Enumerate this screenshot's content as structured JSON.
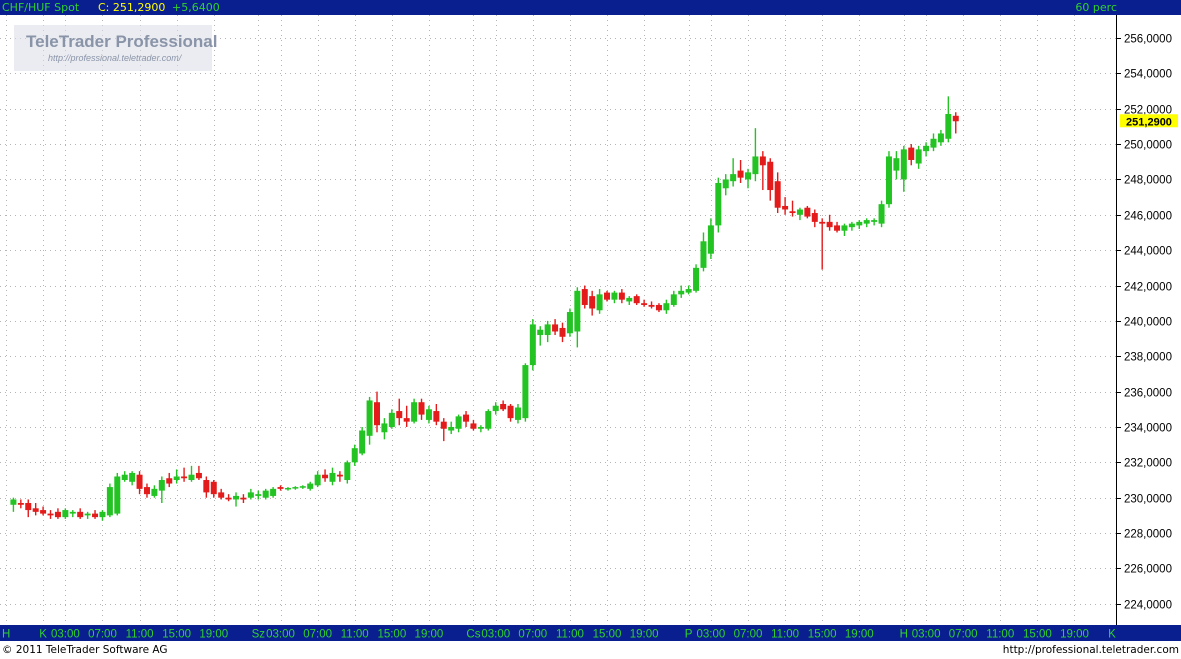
{
  "header": {
    "symbol": "CHF/HUF Spot",
    "close_label": "C: 251,2900",
    "change": "+5,6400",
    "interval": "60 perc"
  },
  "watermark": {
    "brand": "TeleTrader Professional",
    "url": "http://professional.teletrader.com/"
  },
  "footer": {
    "copyright": "© 2011 TeleTrader Software AG",
    "site": "http://professional.teletrader.com"
  },
  "colors": {
    "up": "#22c322",
    "down": "#e31b1b",
    "neutral": "#38d4d4",
    "grid": "#b5b5b5",
    "bar": "#0a1f8f",
    "bar_text": "#2fd12f",
    "highlight": "#ffff00"
  },
  "chart_data": {
    "type": "candlestick",
    "title": "CHF/HUF Spot",
    "interval": "60 perc",
    "last_value": 251.29,
    "last_value_label": "251,2900",
    "y_axis": {
      "position": "right",
      "range": [
        222.8,
        257.3
      ],
      "ticks": [
        224,
        226,
        228,
        230,
        232,
        234,
        236,
        238,
        240,
        242,
        244,
        246,
        248,
        250,
        252,
        254,
        256
      ],
      "tick_labels": [
        "224,0000",
        "226,0000",
        "228,0000",
        "230,0000",
        "232,0000",
        "234,0000",
        "236,0000",
        "238,0000",
        "240,0000",
        "242,0000",
        "244,0000",
        "246,0000",
        "248,0000",
        "250,0000",
        "252,0000",
        "254,0000",
        "256,0000"
      ]
    },
    "x_axis": {
      "slot_count": 150,
      "labels": [
        {
          "slot": 0,
          "text": "H"
        },
        {
          "slot": 5,
          "text": "K"
        },
        {
          "slot": 8,
          "text": "03:00"
        },
        {
          "slot": 13,
          "text": "07:00"
        },
        {
          "slot": 18,
          "text": "11:00"
        },
        {
          "slot": 23,
          "text": "15:00"
        },
        {
          "slot": 28,
          "text": "19:00"
        },
        {
          "slot": 34,
          "text": "Sz"
        },
        {
          "slot": 37,
          "text": "03:00"
        },
        {
          "slot": 42,
          "text": "07:00"
        },
        {
          "slot": 47,
          "text": "11:00"
        },
        {
          "slot": 52,
          "text": "15:00"
        },
        {
          "slot": 57,
          "text": "19:00"
        },
        {
          "slot": 63,
          "text": "Cs"
        },
        {
          "slot": 66,
          "text": "03:00"
        },
        {
          "slot": 71,
          "text": "07:00"
        },
        {
          "slot": 76,
          "text": "11:00"
        },
        {
          "slot": 81,
          "text": "15:00"
        },
        {
          "slot": 86,
          "text": "19:00"
        },
        {
          "slot": 92,
          "text": "P"
        },
        {
          "slot": 95,
          "text": "03:00"
        },
        {
          "slot": 100,
          "text": "07:00"
        },
        {
          "slot": 105,
          "text": "11:00"
        },
        {
          "slot": 110,
          "text": "15:00"
        },
        {
          "slot": 115,
          "text": "19:00"
        },
        {
          "slot": 121,
          "text": "H"
        },
        {
          "slot": 124,
          "text": "03:00"
        },
        {
          "slot": 129,
          "text": "07:00"
        },
        {
          "slot": 134,
          "text": "11:00"
        },
        {
          "slot": 139,
          "text": "15:00"
        },
        {
          "slot": 144,
          "text": "19:00"
        },
        {
          "slot": 150,
          "text": "K"
        }
      ]
    },
    "grid": true,
    "candles": [
      {
        "slot": 1,
        "o": 229.6,
        "h": 230.0,
        "l": 229.2,
        "c": 229.9
      },
      {
        "slot": 2,
        "o": 229.7,
        "h": 229.9,
        "l": 229.4,
        "c": 229.6
      },
      {
        "slot": 3,
        "o": 229.7,
        "h": 229.9,
        "l": 228.9,
        "c": 229.3
      },
      {
        "slot": 4,
        "o": 229.4,
        "h": 229.7,
        "l": 229.0,
        "c": 229.2
      },
      {
        "slot": 5,
        "o": 229.3,
        "h": 229.5,
        "l": 229.0,
        "c": 229.1
      },
      {
        "slot": 6,
        "o": 229.1,
        "h": 229.3,
        "l": 228.8,
        "c": 229.0
      },
      {
        "slot": 7,
        "o": 229.2,
        "h": 229.4,
        "l": 228.8,
        "c": 228.9
      },
      {
        "slot": 8,
        "o": 228.9,
        "h": 229.4,
        "l": 228.8,
        "c": 229.3
      },
      {
        "slot": 9,
        "o": 229.1,
        "h": 229.3,
        "l": 228.9,
        "c": 229.2
      },
      {
        "slot": 10,
        "o": 229.2,
        "h": 229.4,
        "l": 228.8,
        "c": 228.9
      },
      {
        "slot": 11,
        "o": 229.0,
        "h": 229.2,
        "l": 228.8,
        "c": 229.1
      },
      {
        "slot": 12,
        "o": 229.1,
        "h": 229.3,
        "l": 228.8,
        "c": 228.9
      },
      {
        "slot": 13,
        "o": 228.9,
        "h": 229.3,
        "l": 228.7,
        "c": 229.2
      },
      {
        "slot": 14,
        "o": 229.0,
        "h": 230.8,
        "l": 228.9,
        "c": 230.6
      },
      {
        "slot": 15,
        "o": 229.1,
        "h": 231.4,
        "l": 229.0,
        "c": 231.2
      },
      {
        "slot": 16,
        "o": 231.0,
        "h": 231.5,
        "l": 230.9,
        "c": 231.3
      },
      {
        "slot": 17,
        "o": 230.9,
        "h": 231.5,
        "l": 230.7,
        "c": 231.4
      },
      {
        "slot": 18,
        "o": 231.3,
        "h": 231.5,
        "l": 230.2,
        "c": 230.5
      },
      {
        "slot": 19,
        "o": 230.6,
        "h": 230.8,
        "l": 230.0,
        "c": 230.2
      },
      {
        "slot": 20,
        "o": 230.1,
        "h": 230.7,
        "l": 230.0,
        "c": 230.5
      },
      {
        "slot": 21,
        "o": 230.4,
        "h": 231.2,
        "l": 229.7,
        "c": 231.0
      },
      {
        "slot": 22,
        "o": 231.1,
        "h": 231.4,
        "l": 230.6,
        "c": 230.8
      },
      {
        "slot": 23,
        "o": 231.0,
        "h": 231.6,
        "l": 230.8,
        "c": 231.2
      },
      {
        "slot": 24,
        "o": 231.2,
        "h": 231.7,
        "l": 230.9,
        "c": 231.1
      },
      {
        "slot": 25,
        "o": 231.0,
        "h": 231.8,
        "l": 230.9,
        "c": 231.3
      },
      {
        "slot": 26,
        "o": 231.4,
        "h": 231.8,
        "l": 231.0,
        "c": 231.1
      },
      {
        "slot": 27,
        "o": 231.0,
        "h": 231.2,
        "l": 230.0,
        "c": 230.3
      },
      {
        "slot": 28,
        "o": 230.9,
        "h": 231.0,
        "l": 230.0,
        "c": 230.2
      },
      {
        "slot": 29,
        "o": 230.3,
        "h": 230.5,
        "l": 229.9,
        "c": 230.0
      },
      {
        "slot": 30,
        "o": 230.0,
        "h": 230.2,
        "l": 229.8,
        "c": 229.9
      },
      {
        "slot": 31,
        "o": 229.9,
        "h": 230.3,
        "l": 229.5,
        "c": 230.1
      },
      {
        "slot": 32,
        "o": 230.0,
        "h": 230.2,
        "l": 229.7,
        "c": 229.9
      },
      {
        "slot": 33,
        "o": 230.0,
        "h": 230.5,
        "l": 229.9,
        "c": 230.3
      },
      {
        "slot": 34,
        "o": 230.1,
        "h": 230.4,
        "l": 229.9,
        "c": 230.2
      },
      {
        "slot": 35,
        "o": 230.0,
        "h": 230.5,
        "l": 229.9,
        "c": 230.4
      },
      {
        "slot": 36,
        "o": 230.1,
        "h": 230.6,
        "l": 230.0,
        "c": 230.5
      },
      {
        "slot": 37,
        "o": 230.6,
        "h": 230.7,
        "l": 230.4,
        "c": 230.5
      },
      {
        "slot": 38,
        "o": 230.5,
        "h": 230.6,
        "l": 230.4,
        "c": 230.55
      },
      {
        "slot": 39,
        "o": 230.55,
        "h": 230.65,
        "l": 230.45,
        "c": 230.6
      },
      {
        "slot": 40,
        "o": 230.6,
        "h": 230.7,
        "l": 230.5,
        "c": 230.65
      },
      {
        "slot": 41,
        "o": 230.5,
        "h": 230.9,
        "l": 230.4,
        "c": 230.8
      },
      {
        "slot": 42,
        "o": 230.7,
        "h": 231.5,
        "l": 230.6,
        "c": 231.3
      },
      {
        "slot": 43,
        "o": 231.3,
        "h": 231.6,
        "l": 230.9,
        "c": 231.1
      },
      {
        "slot": 44,
        "o": 230.9,
        "h": 231.7,
        "l": 230.7,
        "c": 231.4
      },
      {
        "slot": 45,
        "o": 231.3,
        "h": 231.5,
        "l": 230.9,
        "c": 231.2
      },
      {
        "slot": 46,
        "o": 231.0,
        "h": 232.1,
        "l": 230.8,
        "c": 232.0
      },
      {
        "slot": 47,
        "o": 232.0,
        "h": 233.0,
        "l": 231.8,
        "c": 232.8
      },
      {
        "slot": 48,
        "o": 232.5,
        "h": 234.0,
        "l": 232.4,
        "c": 233.8
      },
      {
        "slot": 49,
        "o": 233.5,
        "h": 235.7,
        "l": 233.0,
        "c": 235.5
      },
      {
        "slot": 50,
        "o": 235.4,
        "h": 236.0,
        "l": 233.7,
        "c": 234.1
      },
      {
        "slot": 51,
        "o": 233.7,
        "h": 234.5,
        "l": 233.3,
        "c": 234.2
      },
      {
        "slot": 52,
        "o": 234.0,
        "h": 235.0,
        "l": 233.9,
        "c": 234.8
      },
      {
        "slot": 53,
        "o": 234.9,
        "h": 235.6,
        "l": 234.1,
        "c": 234.5
      },
      {
        "slot": 54,
        "o": 234.5,
        "h": 235.2,
        "l": 234.0,
        "c": 234.3
      },
      {
        "slot": 55,
        "o": 234.3,
        "h": 235.6,
        "l": 234.2,
        "c": 235.4
      },
      {
        "slot": 56,
        "o": 235.4,
        "h": 235.6,
        "l": 234.4,
        "c": 234.7
      },
      {
        "slot": 57,
        "o": 234.4,
        "h": 235.2,
        "l": 234.2,
        "c": 235.0
      },
      {
        "slot": 58,
        "o": 234.9,
        "h": 235.3,
        "l": 234.1,
        "c": 234.3
      },
      {
        "slot": 59,
        "o": 234.3,
        "h": 234.5,
        "l": 233.2,
        "c": 233.9
      },
      {
        "slot": 60,
        "o": 233.8,
        "h": 234.3,
        "l": 233.6,
        "c": 234.0
      },
      {
        "slot": 61,
        "o": 233.9,
        "h": 234.7,
        "l": 233.7,
        "c": 234.6
      },
      {
        "slot": 62,
        "o": 234.7,
        "h": 234.9,
        "l": 234.0,
        "c": 234.3
      },
      {
        "slot": 63,
        "o": 234.2,
        "h": 234.4,
        "l": 233.8,
        "c": 233.9
      },
      {
        "slot": 64,
        "o": 233.9,
        "h": 234.1,
        "l": 233.7,
        "c": 234.0
      },
      {
        "slot": 65,
        "o": 233.9,
        "h": 235.0,
        "l": 233.8,
        "c": 234.9
      },
      {
        "slot": 66,
        "o": 234.9,
        "h": 235.4,
        "l": 234.7,
        "c": 235.2
      },
      {
        "slot": 67,
        "o": 235.3,
        "h": 235.5,
        "l": 234.9,
        "c": 235.0
      },
      {
        "slot": 68,
        "o": 235.2,
        "h": 235.3,
        "l": 234.3,
        "c": 234.5
      },
      {
        "slot": 69,
        "o": 234.4,
        "h": 235.3,
        "l": 234.2,
        "c": 235.1
      },
      {
        "slot": 70,
        "o": 234.5,
        "h": 237.6,
        "l": 234.3,
        "c": 237.5
      },
      {
        "slot": 71,
        "o": 237.5,
        "h": 240.1,
        "l": 237.2,
        "c": 239.8
      },
      {
        "slot": 72,
        "o": 239.2,
        "h": 239.7,
        "l": 238.6,
        "c": 239.5
      },
      {
        "slot": 73,
        "o": 239.2,
        "h": 240.0,
        "l": 238.8,
        "c": 239.8
      },
      {
        "slot": 74,
        "o": 239.8,
        "h": 240.1,
        "l": 239.2,
        "c": 239.4
      },
      {
        "slot": 75,
        "o": 239.6,
        "h": 239.9,
        "l": 238.8,
        "c": 239.1
      },
      {
        "slot": 76,
        "o": 239.3,
        "h": 240.7,
        "l": 239.1,
        "c": 240.5
      },
      {
        "slot": 77,
        "o": 239.4,
        "h": 241.9,
        "l": 238.5,
        "c": 241.7
      },
      {
        "slot": 78,
        "o": 241.8,
        "h": 242.0,
        "l": 240.7,
        "c": 240.9
      },
      {
        "slot": 79,
        "o": 241.4,
        "h": 241.7,
        "l": 240.3,
        "c": 240.7
      },
      {
        "slot": 80,
        "o": 240.6,
        "h": 241.8,
        "l": 240.4,
        "c": 241.5
      },
      {
        "slot": 81,
        "o": 241.6,
        "h": 241.7,
        "l": 241.1,
        "c": 241.2
      },
      {
        "slot": 82,
        "o": 241.2,
        "h": 241.7,
        "l": 241.0,
        "c": 241.6
      },
      {
        "slot": 83,
        "o": 241.6,
        "h": 241.8,
        "l": 241.0,
        "c": 241.2
      },
      {
        "slot": 84,
        "o": 241.1,
        "h": 241.4,
        "l": 240.9,
        "c": 241.3
      },
      {
        "slot": 85,
        "o": 241.4,
        "h": 241.5,
        "l": 240.9,
        "c": 241.0
      },
      {
        "slot": 86,
        "o": 241.0,
        "h": 241.2,
        "l": 240.8,
        "c": 240.9
      },
      {
        "slot": 87,
        "o": 240.9,
        "h": 241.1,
        "l": 240.7,
        "c": 240.8
      },
      {
        "slot": 88,
        "o": 240.9,
        "h": 241.0,
        "l": 240.5,
        "c": 240.6
      },
      {
        "slot": 89,
        "o": 240.6,
        "h": 241.2,
        "l": 240.4,
        "c": 241.0
      },
      {
        "slot": 90,
        "o": 240.9,
        "h": 241.7,
        "l": 240.8,
        "c": 241.5
      },
      {
        "slot": 91,
        "o": 241.5,
        "h": 242.0,
        "l": 241.3,
        "c": 241.7
      },
      {
        "slot": 92,
        "o": 241.6,
        "h": 242.0,
        "l": 241.5,
        "c": 241.8
      },
      {
        "slot": 93,
        "o": 241.7,
        "h": 243.2,
        "l": 241.6,
        "c": 243.0
      },
      {
        "slot": 94,
        "o": 243.0,
        "h": 245.0,
        "l": 242.8,
        "c": 244.5
      },
      {
        "slot": 95,
        "o": 243.8,
        "h": 245.8,
        "l": 243.5,
        "c": 245.4
      },
      {
        "slot": 96,
        "o": 245.4,
        "h": 248.1,
        "l": 245.0,
        "c": 247.8
      },
      {
        "slot": 97,
        "o": 247.5,
        "h": 248.3,
        "l": 247.1,
        "c": 248.0
      },
      {
        "slot": 98,
        "o": 247.9,
        "h": 249.2,
        "l": 247.6,
        "c": 248.3
      },
      {
        "slot": 99,
        "o": 248.5,
        "h": 249.1,
        "l": 247.8,
        "c": 248.1
      },
      {
        "slot": 100,
        "o": 248.0,
        "h": 248.6,
        "l": 247.5,
        "c": 248.4
      },
      {
        "slot": 101,
        "o": 248.3,
        "h": 250.9,
        "l": 247.9,
        "c": 249.3
      },
      {
        "slot": 102,
        "o": 249.3,
        "h": 249.6,
        "l": 247.4,
        "c": 248.8
      },
      {
        "slot": 103,
        "o": 249.0,
        "h": 249.2,
        "l": 246.8,
        "c": 247.4
      },
      {
        "slot": 104,
        "o": 247.9,
        "h": 248.4,
        "l": 246.1,
        "c": 246.4
      },
      {
        "slot": 105,
        "o": 246.5,
        "h": 247.0,
        "l": 246.0,
        "c": 246.3
      },
      {
        "slot": 106,
        "o": 246.2,
        "h": 246.8,
        "l": 245.9,
        "c": 246.1
      },
      {
        "slot": 107,
        "o": 246.0,
        "h": 246.4,
        "l": 245.7,
        "c": 246.3
      },
      {
        "slot": 108,
        "o": 246.4,
        "h": 246.5,
        "l": 245.8,
        "c": 245.9
      },
      {
        "slot": 109,
        "o": 246.1,
        "h": 246.3,
        "l": 245.3,
        "c": 245.6
      },
      {
        "slot": 110,
        "o": 245.6,
        "h": 245.8,
        "l": 242.9,
        "c": 245.5
      },
      {
        "slot": 111,
        "o": 245.6,
        "h": 246.0,
        "l": 245.1,
        "c": 245.3
      },
      {
        "slot": 112,
        "o": 245.4,
        "h": 245.6,
        "l": 245.0,
        "c": 245.1
      },
      {
        "slot": 113,
        "o": 245.1,
        "h": 245.5,
        "l": 244.8,
        "c": 245.4
      },
      {
        "slot": 114,
        "o": 245.3,
        "h": 245.6,
        "l": 245.1,
        "c": 245.5
      },
      {
        "slot": 115,
        "o": 245.4,
        "h": 245.7,
        "l": 245.2,
        "c": 245.6
      },
      {
        "slot": 116,
        "o": 245.5,
        "h": 245.8,
        "l": 245.3,
        "c": 245.7
      },
      {
        "slot": 117,
        "o": 245.6,
        "h": 245.8,
        "l": 245.4,
        "c": 245.7
      },
      {
        "slot": 118,
        "o": 245.5,
        "h": 246.8,
        "l": 245.3,
        "c": 246.6
      },
      {
        "slot": 119,
        "o": 246.6,
        "h": 249.6,
        "l": 246.4,
        "c": 249.3
      },
      {
        "slot": 120,
        "o": 248.5,
        "h": 249.6,
        "l": 248.0,
        "c": 249.2
      },
      {
        "slot": 121,
        "o": 248.0,
        "h": 249.9,
        "l": 247.3,
        "c": 249.7
      },
      {
        "slot": 122,
        "o": 249.8,
        "h": 250.0,
        "l": 248.8,
        "c": 249.1
      },
      {
        "slot": 123,
        "o": 248.9,
        "h": 249.9,
        "l": 248.6,
        "c": 249.7
      },
      {
        "slot": 124,
        "o": 249.6,
        "h": 250.1,
        "l": 249.3,
        "c": 249.9
      },
      {
        "slot": 125,
        "o": 249.8,
        "h": 250.6,
        "l": 249.6,
        "c": 250.3
      },
      {
        "slot": 126,
        "o": 250.1,
        "h": 250.8,
        "l": 249.9,
        "c": 250.6
      },
      {
        "slot": 127,
        "o": 250.3,
        "h": 252.7,
        "l": 250.1,
        "c": 251.7
      },
      {
        "slot": 128,
        "o": 251.6,
        "h": 251.8,
        "l": 250.6,
        "c": 251.29
      }
    ]
  }
}
